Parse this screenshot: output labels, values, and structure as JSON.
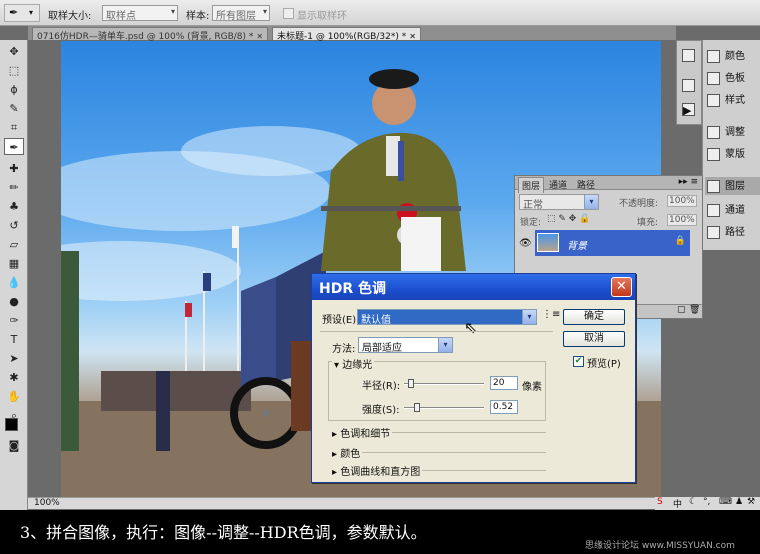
{
  "options_bar": {
    "sample_size_label": "取样大小:",
    "sample_size_value": "取样点",
    "sample_label": "样本:",
    "sample_value": "所有图层",
    "show_ring_label": "显示取样环"
  },
  "doc_tabs": [
    {
      "label": "0716仿HDR—骑单车.psd @ 100% (背景, RGB/8) *"
    },
    {
      "label": "未标题-1 @ 100%(RGB/32*) *"
    }
  ],
  "status": {
    "zoom": "100%"
  },
  "right_dock": {
    "items": [
      {
        "label": "颜色"
      },
      {
        "label": "色板"
      },
      {
        "label": "样式"
      },
      {
        "label": "调整"
      },
      {
        "label": "蒙版"
      },
      {
        "label": "图层"
      },
      {
        "label": "通道"
      },
      {
        "label": "路径"
      }
    ]
  },
  "layers_panel": {
    "tabs": [
      "图层",
      "通道",
      "路径"
    ],
    "blend_mode": "正常",
    "opacity_label": "不透明度:",
    "opacity_value": "100%",
    "lock_label": "锁定:",
    "fill_label": "填充:",
    "fill_value": "100%",
    "layer_name": "背景"
  },
  "hdr_dialog": {
    "title": "HDR 色调",
    "preset_label": "预设(E):",
    "preset_value": "默认值",
    "method_label": "方法:",
    "method_value": "局部适应",
    "edge_glow_label": "边缘光",
    "radius_label": "半径(R):",
    "radius_value": "20",
    "radius_unit": "像素",
    "radius_level": 0.05,
    "strength_label": "强度(S):",
    "strength_value": "0.52",
    "strength_level": 0.13,
    "section_tone_detail": "色调和细节",
    "section_color": "颜色",
    "section_curve": "色调曲线和直方图",
    "ok_label": "确定",
    "cancel_label": "取消",
    "preview_label": "预览(P)",
    "preview_checked": true
  },
  "caption": {
    "text": "3、拼合图像，执行：图像--调整--HDR色调，参数默认。",
    "watermark": "思缘设计论坛 www.MISSYUAN.com"
  }
}
